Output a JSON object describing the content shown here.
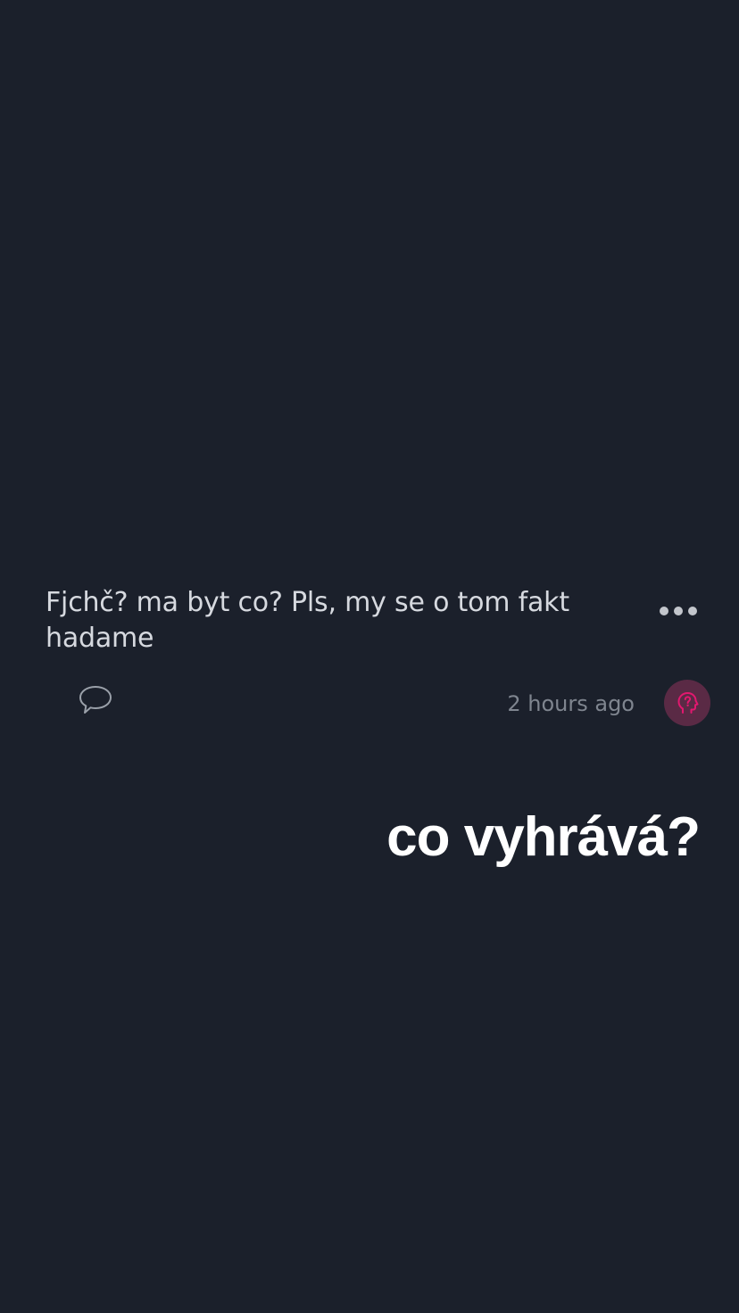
{
  "post": {
    "text": "Fjchč? ma byt co? Pls, my se o tom fakt hadame",
    "timestamp": "2 hours ago",
    "avatar_icon": "question-head-icon",
    "avatar_color": "#e2186f",
    "comment_icon": "comment-bubble-icon",
    "more_icon": "more-dots-icon"
  },
  "caption": {
    "text": "co vyhrává?"
  },
  "colors": {
    "background": "#1b202b",
    "text": "#d6d9df",
    "muted": "#7f858f",
    "accent": "#e2186f"
  }
}
